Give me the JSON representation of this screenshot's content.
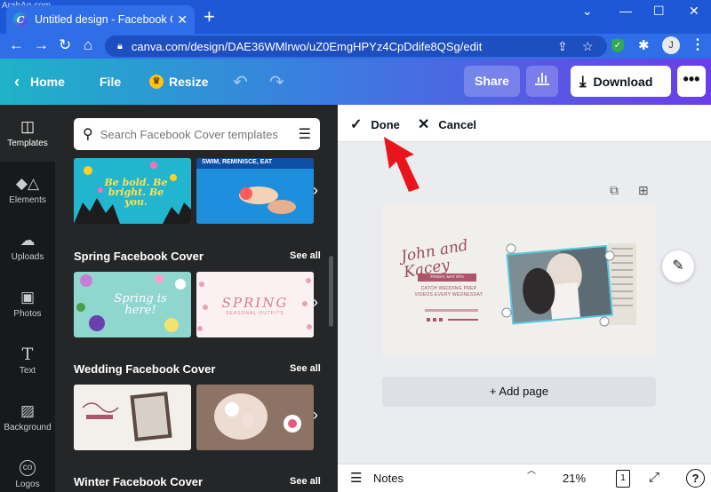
{
  "watermark": "ArabAq.com",
  "browser": {
    "tab_title": "Untitled design - Facebook Cover",
    "url": "canva.com/design/DAE36WMlrwo/uZ0EmgHPYz4CpDdife8QSg/edit",
    "profile_initial": "J"
  },
  "header": {
    "home": "Home",
    "file": "File",
    "resize": "Resize",
    "share": "Share",
    "download": "Download"
  },
  "rail": [
    {
      "label": "Templates",
      "icon": "templates-icon"
    },
    {
      "label": "Elements",
      "icon": "elements-icon"
    },
    {
      "label": "Uploads",
      "icon": "uploads-icon"
    },
    {
      "label": "Photos",
      "icon": "photos-icon"
    },
    {
      "label": "Text",
      "icon": "text-icon"
    },
    {
      "label": "Background",
      "icon": "background-icon"
    },
    {
      "label": "Logos",
      "icon": "logos-icon"
    }
  ],
  "panel": {
    "search_placeholder": "Search Facebook Cover templates",
    "see_all": "See all",
    "sections": [
      {
        "title": "Spring Facebook Cover"
      },
      {
        "title": "Wedding Facebook Cover"
      },
      {
        "title": "Winter Facebook Cover"
      }
    ],
    "thumbs": {
      "bebold": "Be bold. Be bright. Be you.",
      "swim": "SWIM, REMINISCE, EAT",
      "spring_here": "Spring is here!",
      "spring": "SPRING",
      "spring_sub": "SEASONAL OUTFITS"
    }
  },
  "crop": {
    "done": "Done",
    "cancel": "Cancel"
  },
  "design": {
    "names": "John and Kacey",
    "tag": "FRIDAY, MAY 8TH",
    "caption": "CATCH WEDDING PREP VIDEOS EVERY WEDNESDAY"
  },
  "editor": {
    "add_page": "+ Add page",
    "notes": "Notes",
    "zoom": "21%",
    "page_count": "1"
  },
  "colors": {
    "accent_red": "#e8151b",
    "crop_frame": "#5ac8e0"
  }
}
